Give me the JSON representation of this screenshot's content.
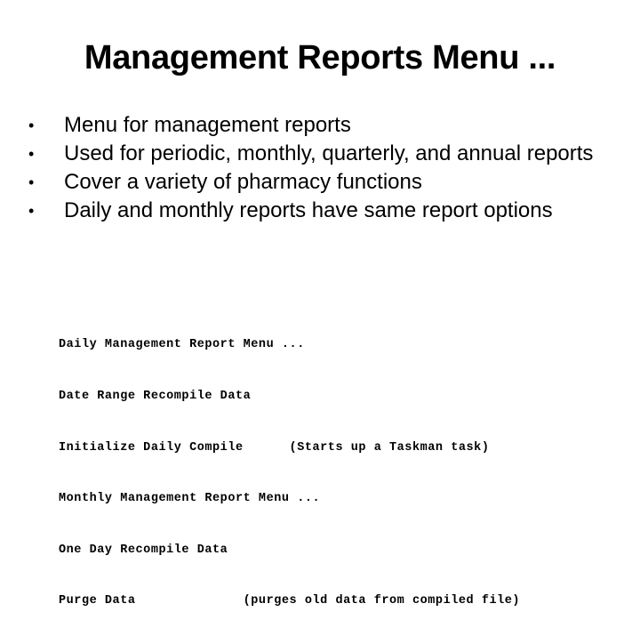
{
  "slide": {
    "title": "Management Reports Menu ...",
    "bullet_glyph": "•",
    "bullets": [
      "Menu for management reports",
      "Used for periodic, monthly, quarterly, and annual reports",
      "Cover a variety of pharmacy functions",
      "Daily and monthly reports have same report options"
    ],
    "menu_options": [
      "Daily Management Report Menu ...",
      "Date Range Recompile Data",
      "Initialize Daily Compile      (Starts up a Taskman task)",
      "Monthly Management Report Menu ...",
      "One Day Recompile Data",
      "Purge Data              (purges old data from compiled file)"
    ]
  }
}
